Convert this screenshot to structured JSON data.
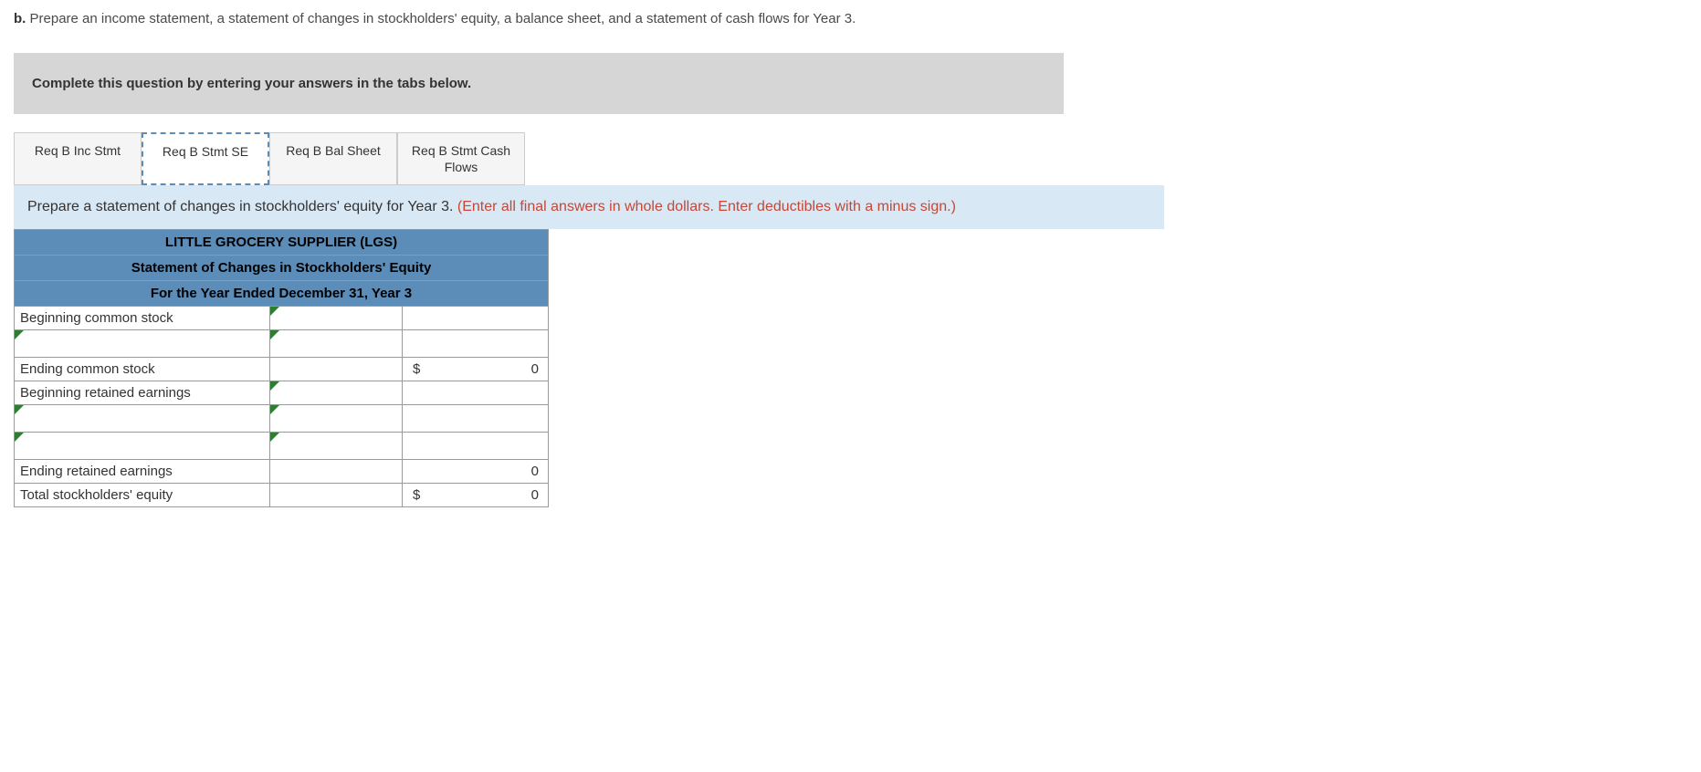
{
  "question": {
    "label": "b.",
    "text": " Prepare an income statement, a statement of changes in stockholders' equity, a balance sheet, and a statement of cash flows for Year 3."
  },
  "instruction": "Complete this question by entering your answers in the tabs below.",
  "tabs": [
    {
      "label": "Req B Inc Stmt"
    },
    {
      "label": "Req B Stmt SE"
    },
    {
      "label": "Req B Bal Sheet"
    },
    {
      "label": "Req B Stmt Cash Flows"
    }
  ],
  "tabContent": {
    "main": "Prepare a statement of changes in stockholders' equity for Year 3. ",
    "hint": "(Enter all final answers in whole dollars. Enter deductibles with a minus sign.)"
  },
  "worksheet": {
    "title1": "LITTLE GROCERY SUPPLIER (LGS)",
    "title2": "Statement of Changes in Stockholders' Equity",
    "title3": "For the Year Ended December 31, Year 3",
    "rows": {
      "r1_label": "Beginning common stock",
      "r3_label": "Ending common stock",
      "r3_dollar": "$",
      "r3_value": "0",
      "r4_label": "Beginning retained earnings",
      "r7_label": "Ending retained earnings",
      "r7_value": "0",
      "r8_label": "Total stockholders' equity",
      "r8_dollar": "$",
      "r8_value": "0"
    }
  }
}
